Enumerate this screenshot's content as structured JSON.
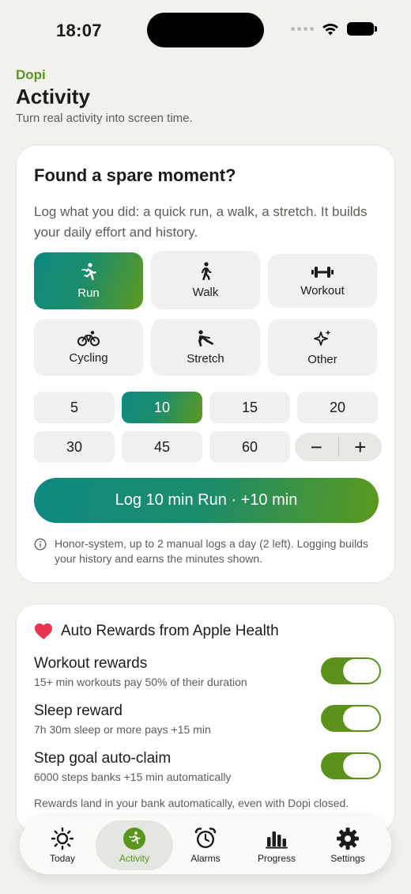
{
  "status_bar": {
    "time": "18:07"
  },
  "header": {
    "app_name": "Dopi",
    "title": "Activity",
    "subtitle": "Turn real activity into screen time."
  },
  "log_card": {
    "title": "Found a spare moment?",
    "description": "Log what you did: a quick run, a walk, a stretch. It builds your daily effort and history.",
    "activities": [
      {
        "label": "Run",
        "icon": "running-icon",
        "selected": true
      },
      {
        "label": "Walk",
        "icon": "walking-icon",
        "selected": false
      },
      {
        "label": "Workout",
        "icon": "dumbbell-icon",
        "selected": false
      },
      {
        "label": "Cycling",
        "icon": "bicycle-icon",
        "selected": false
      },
      {
        "label": "Stretch",
        "icon": "stretch-icon",
        "selected": false
      },
      {
        "label": "Other",
        "icon": "sparkles-icon",
        "selected": false
      }
    ],
    "durations": [
      "5",
      "10",
      "15",
      "20",
      "30",
      "45",
      "60"
    ],
    "selected_duration": "10",
    "stepper": {
      "minus": "−",
      "plus": "+"
    },
    "log_button": "Log 10 min Run · +10 min",
    "info": "Honor-system, up to 2 manual logs a day (2 left). Logging builds your history and earns the minutes shown."
  },
  "health_card": {
    "title": "Auto Rewards from Apple Health",
    "rewards": [
      {
        "title": "Workout rewards",
        "subtitle": "15+ min workouts pay 50% of their duration",
        "enabled": true
      },
      {
        "title": "Sleep reward",
        "subtitle": "7h 30m sleep or more pays +15 min",
        "enabled": true
      },
      {
        "title": "Step goal auto-claim",
        "subtitle": "6000 steps banks +15 min automatically",
        "enabled": true
      }
    ],
    "footer": "Rewards land in your bank automatically, even with Dopi closed."
  },
  "tabbar": {
    "tabs": [
      {
        "label": "Today",
        "icon": "sun-icon",
        "active": false
      },
      {
        "label": "Activity",
        "icon": "running-icon",
        "active": true
      },
      {
        "label": "Alarms",
        "icon": "alarm-clock-icon",
        "active": false
      },
      {
        "label": "Progress",
        "icon": "bar-chart-icon",
        "active": false
      },
      {
        "label": "Settings",
        "icon": "gear-icon",
        "active": false
      }
    ]
  },
  "colors": {
    "accent_green": "#5a961f",
    "gradient_teal": "#0f8a7e",
    "toggle_on": "#5b931a",
    "heart": "#e8364f",
    "background": "#f1f2ee"
  }
}
